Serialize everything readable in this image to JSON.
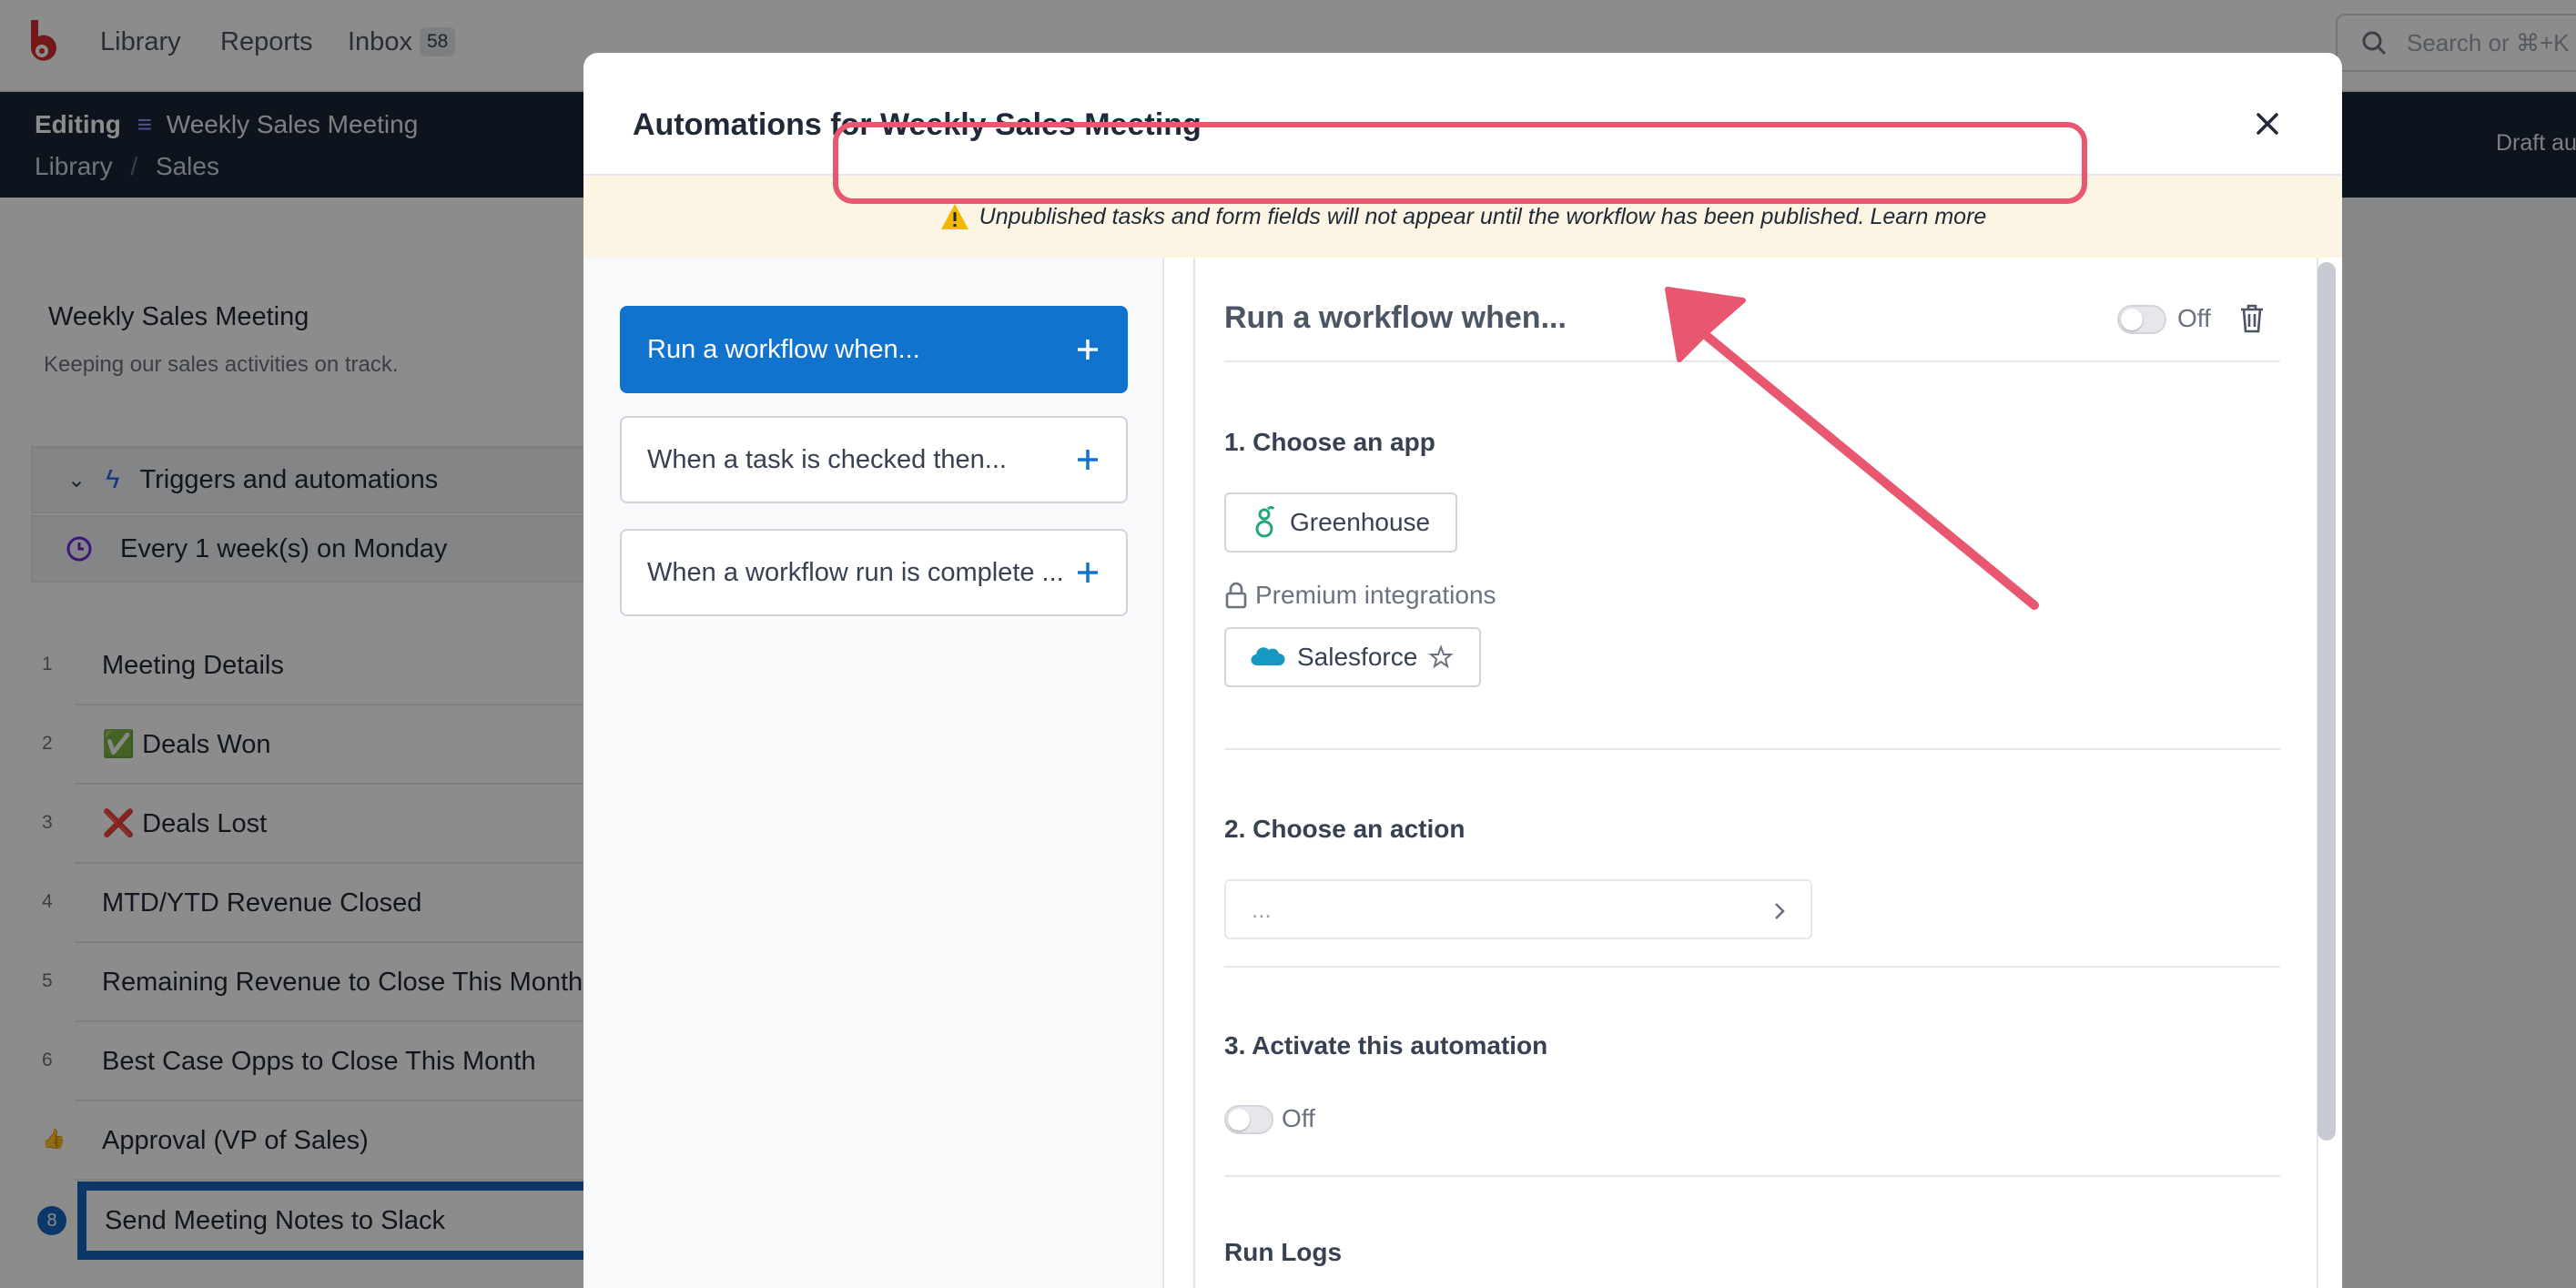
{
  "nav": {
    "links": [
      "Library",
      "Reports",
      "Inbox"
    ],
    "inbox_count": "58",
    "search_placeholder": "Search or ⌘+K"
  },
  "editbar": {
    "editing_label": "Editing",
    "workflow_name": "Weekly Sales Meeting",
    "breadcrumb": [
      "Library",
      "/",
      "Sales"
    ],
    "status_text": "Draft au"
  },
  "background": {
    "workflow_title": "Weekly Sales Meeting",
    "workflow_description": "Keeping our sales activities on track.",
    "triggers_label": "Triggers and automations",
    "schedule_label": "Every 1 week(s) on Monday",
    "tasks": [
      {
        "num": "1",
        "label": "Meeting Details"
      },
      {
        "num": "2",
        "label": "✅ Deals Won"
      },
      {
        "num": "3",
        "label": "❌ Deals Lost"
      },
      {
        "num": "4",
        "label": "MTD/YTD Revenue Closed"
      },
      {
        "num": "5",
        "label": "Remaining Revenue to Close This Month"
      },
      {
        "num": "6",
        "label": "Best Case Opps to Close This Month"
      },
      {
        "num": "",
        "label": "Approval (VP of Sales)"
      },
      {
        "num": "8",
        "label": "Send Meeting Notes to Slack"
      }
    ]
  },
  "modal": {
    "title": "Automations for Weekly Sales Meeting",
    "warning_text": "Unpublished tasks and form fields will not appear until the workflow has been published.",
    "learn_more": "Learn more",
    "rules": [
      "Run a workflow when...",
      "When a task is checked then...",
      "When a workflow run is complete ..."
    ],
    "panel_title": "Run a workflow when...",
    "toggle_off": "Off",
    "step1": "1. Choose an app",
    "app_greenhouse": "Greenhouse",
    "premium_label": "Premium integrations",
    "app_salesforce": "Salesforce",
    "step2": "2. Choose an action",
    "action_placeholder": "...",
    "step3": "3. Activate this automation",
    "activate_off": "Off",
    "run_logs": "Run Logs"
  },
  "colors": {
    "primary": "#1273cf",
    "warning_bg": "#fdf5e3",
    "annotation": "#e8566f",
    "brand": "#d32f2f"
  }
}
